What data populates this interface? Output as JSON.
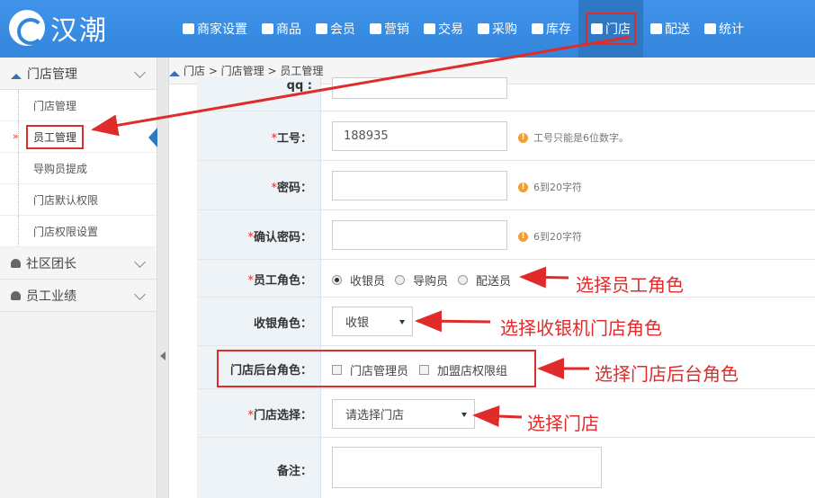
{
  "app": {
    "logo_text": "汉潮"
  },
  "nav": [
    {
      "label": "商家设置",
      "icon": "gear-icon"
    },
    {
      "label": "商品",
      "icon": "coins-icon"
    },
    {
      "label": "会员",
      "icon": "user-icon"
    },
    {
      "label": "营销",
      "icon": "cup-icon"
    },
    {
      "label": "交易",
      "icon": "document-icon"
    },
    {
      "label": "采购",
      "icon": "cup-icon"
    },
    {
      "label": "库存",
      "icon": "store-icon"
    },
    {
      "label": "门店",
      "icon": "home-icon",
      "active": true
    },
    {
      "label": "配送",
      "icon": "truck-icon"
    },
    {
      "label": "统计",
      "icon": "bar-chart-icon"
    }
  ],
  "sidebar": {
    "group_store": "门店管理",
    "items": [
      "门店管理",
      "员工管理",
      "导购员提成",
      "门店默认权限",
      "门店权限设置"
    ],
    "active_index": 1,
    "group_community": "社区团长",
    "group_performance": "员工业绩"
  },
  "breadcrumb": {
    "text": "门店 > 门店管理 > 员工管理"
  },
  "form": {
    "top_partial_label": "qq :",
    "emp_no": {
      "label": "工号：",
      "value": "188935",
      "hint": "工号只能是6位数字。"
    },
    "password": {
      "label": "密码：",
      "value": "",
      "hint": "6到20字符"
    },
    "confirm": {
      "label": "确认密码：",
      "value": "",
      "hint": "6到20字符"
    },
    "role": {
      "label": "员工角色：",
      "options": [
        "收银员",
        "导购员",
        "配送员"
      ],
      "selected": 0
    },
    "cashier_role": {
      "label": "收银角色：",
      "value": "收银"
    },
    "backend_role": {
      "label": "门店后台角色：",
      "options": [
        "门店管理员",
        "加盟店权限组"
      ]
    },
    "store_select": {
      "label": "门店选择：",
      "value": "请选择门店"
    },
    "remark": {
      "label": "备注："
    },
    "required_mark": "*"
  },
  "annotations": {
    "role": "选择员工角色",
    "cashier": "选择收银机门店角色",
    "backend": "选择门店后台角色",
    "store": "选择门店"
  },
  "colors": {
    "topbar": "#3486dc",
    "annotation": "#e02b2b",
    "label_column": "#eef3f8"
  }
}
